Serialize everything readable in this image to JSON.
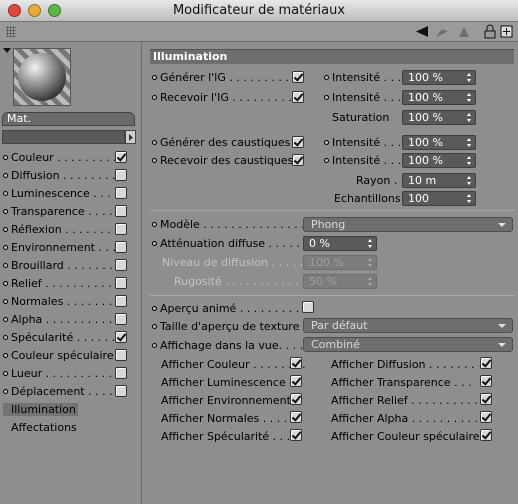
{
  "window": {
    "title": "Modificateur de matériaux"
  },
  "sidebar": {
    "material_name": "Mat.",
    "channels": [
      {
        "label": "Couleur . . . . . . . . .",
        "checked": true
      },
      {
        "label": "Diffusion . . . . . . . .",
        "checked": false
      },
      {
        "label": "Luminescence . . . . .",
        "checked": false
      },
      {
        "label": "Transparence . . . .",
        "checked": false
      },
      {
        "label": "Réflexion . . . . . . . .",
        "checked": false
      },
      {
        "label": "Environnement . . . .",
        "checked": false
      },
      {
        "label": "Brouillard . . . . . . . .",
        "checked": false
      },
      {
        "label": "Relief . . . . . . . . . . .",
        "checked": false
      },
      {
        "label": "Normales . . . . . . . .",
        "checked": false
      },
      {
        "label": "Alpha . . . . . . . . . . .",
        "checked": false
      },
      {
        "label": "Spécularité . . . . . .",
        "checked": true
      },
      {
        "label": "Couleur spéculaire",
        "checked": false
      },
      {
        "label": "Lueur . . . . . . . . . . .",
        "checked": false
      },
      {
        "label": "Déplacement . . . . .",
        "checked": false
      }
    ],
    "illumination": "Illumination",
    "affectations": "Affectations"
  },
  "panel": {
    "header": "Illumination",
    "gi": {
      "generate_label": "Générer l'IG . . . . . . . . . .",
      "generate_checked": true,
      "receive_label": "Recevoir l'IG . . . . . . . . .",
      "receive_checked": true,
      "intensity1_label": "Intensité . . .",
      "intensity1_value": "100 %",
      "intensity2_label": "Intensité . . .",
      "intensity2_value": "100 %",
      "saturation_label": "Saturation",
      "saturation_value": "100 %"
    },
    "caustics": {
      "generate_label": "Générer des caustiques",
      "generate_checked": true,
      "receive_label": "Recevoir des caustiques",
      "receive_checked": true,
      "intensity1_label": "Intensité . . .",
      "intensity1_value": "100 %",
      "intensity2_label": "Intensité . . .",
      "intensity2_value": "100 %",
      "radius_label": "Rayon . . .",
      "radius_value": "10 m",
      "samples_label": "Echantillons",
      "samples_value": "100"
    },
    "model": {
      "model_label": "Modèle . . . . . . . . . . . . . . . . .",
      "model_value": "Phong",
      "atten_label": "Atténuation diffuse . . . . .",
      "atten_value": "0 %",
      "level_label": "Niveau de diffusion . . . . .",
      "level_value": "100 %",
      "rough_label": "Rugosité . . . . . . . . . . . . .",
      "rough_value": "50 %"
    },
    "preview": {
      "animated_label": "Aperçu animé . . . . . . . . . . .",
      "animated_checked": false,
      "size_label": "Taille d'aperçu de texture",
      "size_value": "Par défaut",
      "display_label": "Affichage dans la vue. . . . . .",
      "display_value": "Combiné",
      "show_items": [
        {
          "label": "Afficher Couleur . . . . . . . .",
          "checked": true
        },
        {
          "label": "Afficher Diffusion . . . . . . .",
          "checked": true
        },
        {
          "label": "Afficher Luminescence",
          "checked": true
        },
        {
          "label": "Afficher Transparence . . .",
          "checked": true
        },
        {
          "label": "Afficher Environnement",
          "checked": true
        },
        {
          "label": "Afficher Relief . . . . . . . . . .",
          "checked": true
        },
        {
          "label": "Afficher Normales . . . . . .",
          "checked": true
        },
        {
          "label": "Afficher Alpha . . . . . . . . . .",
          "checked": true
        },
        {
          "label": "Afficher Spécularité . . .",
          "checked": true
        },
        {
          "label": "Afficher Couleur spéculaire",
          "checked": true
        }
      ]
    }
  },
  "colors": {
    "field_bg": "#5a5a5a",
    "panel_bg": "#8e8e8e",
    "header_bg": "#6e6e6e"
  }
}
